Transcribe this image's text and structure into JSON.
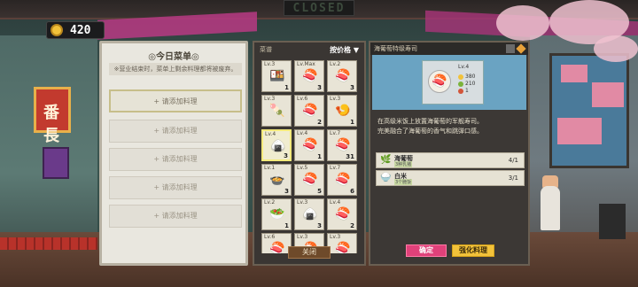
{
  "header": {
    "closed_sign": "CLOSED",
    "coins": "420",
    "coin_icon": "gold-coin-icon"
  },
  "menu": {
    "title": "◎今日菜单◎",
    "note": "※营业结束时，菜单上剩余料理都将被废弃。",
    "slots": [
      "+ 请添加料理",
      "+ 请添加料理",
      "+ 请添加料理",
      "+ 请添加料理",
      "+ 请添加料理"
    ]
  },
  "recipes": {
    "category": "菜谱",
    "sort_label": "按价格 ▼",
    "close_label": "关闭",
    "items": [
      {
        "lv": "Lv.3",
        "qty": "1",
        "food": "🍱"
      },
      {
        "lv": "Lv.Max",
        "qty": "3",
        "food": "🍣"
      },
      {
        "lv": "Lv.2",
        "qty": "3",
        "food": "🍣"
      },
      {
        "lv": "Lv.3",
        "qty": "",
        "food": "🍡"
      },
      {
        "lv": "Lv.6",
        "qty": "2",
        "food": "🍣"
      },
      {
        "lv": "Lv.3",
        "qty": "1",
        "food": "🍤"
      },
      {
        "lv": "Lv.4",
        "qty": "3",
        "food": "🍙"
      },
      {
        "lv": "Lv.4",
        "qty": "1",
        "food": "🍣"
      },
      {
        "lv": "Lv.7",
        "qty": "31",
        "food": "🍣"
      },
      {
        "lv": "Lv.1",
        "qty": "3",
        "food": "🍲"
      },
      {
        "lv": "Lv.5",
        "qty": "5",
        "food": "🍣"
      },
      {
        "lv": "Lv.7",
        "qty": "6",
        "food": "🍣"
      },
      {
        "lv": "Lv.2",
        "qty": "1",
        "food": "🥗"
      },
      {
        "lv": "Lv.3",
        "qty": "3",
        "food": "🍙"
      },
      {
        "lv": "Lv.4",
        "qty": "2",
        "food": "🍣"
      },
      {
        "lv": "Lv.6",
        "qty": "",
        "food": "🍣"
      },
      {
        "lv": "Lv.3",
        "qty": "",
        "food": "🍣"
      },
      {
        "lv": "Lv.3",
        "qty": "",
        "food": "🍣"
      }
    ]
  },
  "detail": {
    "title": "海葡萄特级寿司",
    "card_lv": "Lv.4",
    "price": "380",
    "stat2": "210",
    "stat3": "1",
    "description_line1": "在高级米饭上放置海葡萄的军舰寿司。",
    "description_line2": "完美融合了海葡萄的香气和跳弹口感。",
    "ingredients": [
      {
        "name": "海葡萄",
        "sub": "3种乳猪",
        "count": "4/1",
        "icon": "🌿"
      },
      {
        "name": "白米",
        "sub": "3个脆饭",
        "count": "3/1",
        "icon": "🍚"
      }
    ],
    "confirm_label": "确定",
    "enhance_label": "强化料理"
  }
}
